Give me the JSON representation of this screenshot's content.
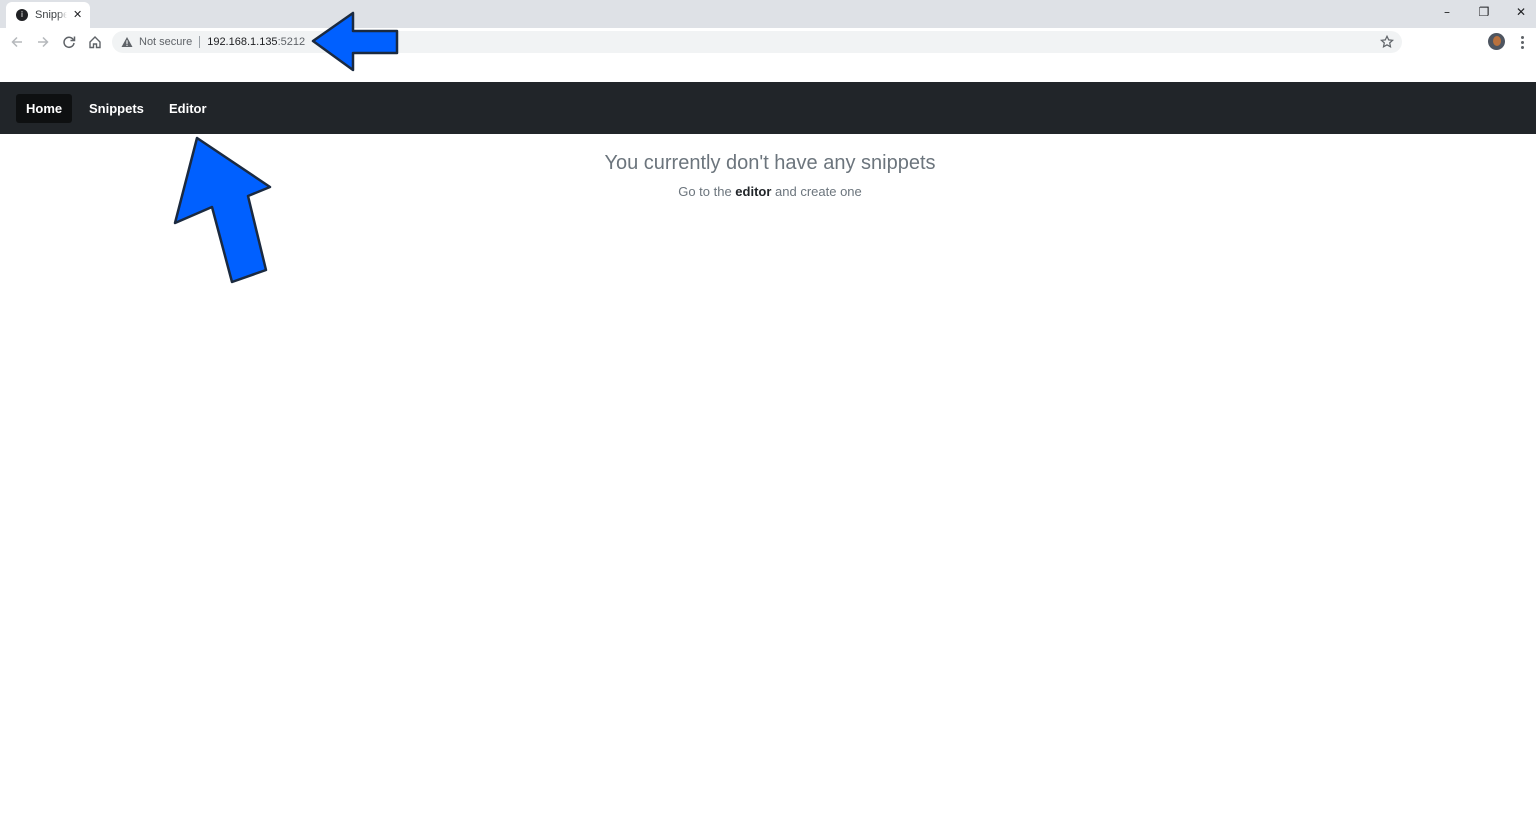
{
  "browser": {
    "tab_title": "Snippets",
    "tab_favicon": "i",
    "tab_close": "✕",
    "security_label": "Not secure",
    "url_host": "192.168.1.135",
    "url_port": ":5212",
    "icons": [
      "back-arrow-icon",
      "forward-arrow-icon",
      "reload-icon",
      "home-icon",
      "warning-icon",
      "star-icon",
      "profile-avatar",
      "kebab-menu-icon"
    ],
    "window_controls": {
      "minimize": "–",
      "maximize": "❐",
      "close": "✕"
    }
  },
  "navbar": {
    "items": [
      {
        "label": "Home",
        "active": true
      },
      {
        "label": "Snippets",
        "active": false
      },
      {
        "label": "Editor",
        "active": false
      }
    ]
  },
  "main": {
    "empty_title": "You currently don't have any snippets",
    "empty_prefix": "Go to the ",
    "empty_link": "editor",
    "empty_suffix": " and create one"
  },
  "colors": {
    "navbar_bg": "#212529",
    "active_item_bg": "#0e1011",
    "annotation_arrow": "#0060ff"
  }
}
